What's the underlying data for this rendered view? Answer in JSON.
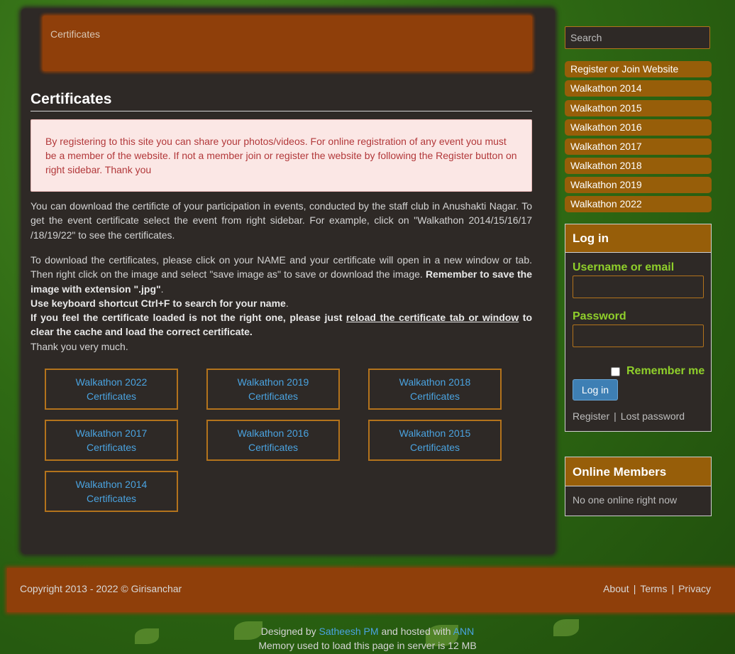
{
  "breadcrumb": "Certificates",
  "page_title": "Certificates",
  "notice": "By registering to this site you can share your photos/videos. For online registration of any event you must be a member of the website. If not a member join or register the website by following the Register button on right sidebar. Thank you",
  "intro": {
    "p1": "You can download the certificte of your participation in events, conducted by the staff club in Anushakti Nagar. To get the event certificate select the event from right sidebar. For example, click on \"Walkathon 2014/15/16/17 /18/19/22\" to see the certificates.",
    "p2_start": "To download the certificates, please click on your NAME and your certificate will open in a new window or tab. Then right click on the image and select \"save image as\" to save or download the image.",
    "p2_bold": "Remember to save the image with extension \".jpg\"",
    "p2_end": ".",
    "line_shortcut": "Use keyboard shortcut Ctrl+F to search for your name",
    "line_shortcut_end": ".",
    "line_reload_a": "If you feel the certificate loaded is not the right one, please just",
    "line_reload_link": "reload the certificate tab or window",
    "line_reload_b": "to clear the cache and load the correct certificate.",
    "thanks": "Thank you very much."
  },
  "cert_buttons": [
    {
      "line1": "Walkathon 2022",
      "line2": "Certificates"
    },
    {
      "line1": "Walkathon 2019",
      "line2": "Certificates"
    },
    {
      "line1": "Walkathon 2018",
      "line2": "Certificates"
    },
    {
      "line1": "Walkathon 2017",
      "line2": "Certificates"
    },
    {
      "line1": "Walkathon 2016",
      "line2": "Certificates"
    },
    {
      "line1": "Walkathon 2015",
      "line2": "Certificates"
    },
    {
      "line1": "Walkathon 2014",
      "line2": "Certificates"
    }
  ],
  "sidebar": {
    "search_placeholder": "Search",
    "links": [
      "Register or Join Website",
      "Walkathon 2014",
      "Walkathon 2015",
      "Walkathon 2016",
      "Walkathon 2017",
      "Walkathon 2018",
      "Walkathon 2019",
      "Walkathon 2022"
    ],
    "login": {
      "title": "Log in",
      "username_label": "Username or email",
      "password_label": "Password",
      "remember_label": "Remember me",
      "remember_checked": false,
      "button": "Log in",
      "register": "Register",
      "lost_password": "Lost password"
    },
    "online": {
      "title": "Online Members",
      "text": "No one online right now"
    }
  },
  "footer": {
    "copyright": "Copyright 2013 - 2022 © Girisanchar",
    "links": [
      "About",
      "Terms",
      "Privacy"
    ],
    "designed_by": "Designed by",
    "designer": "Satheesh PM",
    "hosted_with": "and hosted with",
    "host": "ANN",
    "memory": "Memory used to load this page in server is 12 MB"
  },
  "colors": {
    "background_green": "#2f6a14",
    "panel": "#2e2926",
    "rust": "#8f3f0a",
    "amber": "#975e09",
    "link_blue": "#4aa3e0",
    "label_green": "#8fcf2b",
    "notice_text": "#b2383a"
  }
}
